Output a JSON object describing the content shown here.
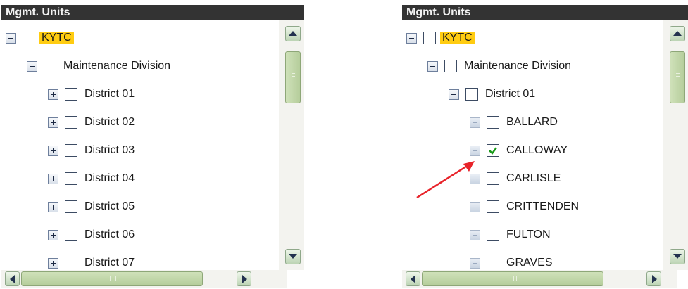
{
  "left_panel": {
    "title": "Mgmt. Units",
    "nodes": [
      {
        "label": "KYTC",
        "level": 0,
        "expander": "minus",
        "checked": false,
        "highlight": true
      },
      {
        "label": "Maintenance Division",
        "level": 1,
        "expander": "minus",
        "checked": false
      },
      {
        "label": "District 01",
        "level": 2,
        "expander": "plus",
        "checked": false
      },
      {
        "label": "District 02",
        "level": 2,
        "expander": "plus",
        "checked": false
      },
      {
        "label": "District 03",
        "level": 2,
        "expander": "plus",
        "checked": false
      },
      {
        "label": "District 04",
        "level": 2,
        "expander": "plus",
        "checked": false
      },
      {
        "label": "District 05",
        "level": 2,
        "expander": "plus",
        "checked": false
      },
      {
        "label": "District 06",
        "level": 2,
        "expander": "plus",
        "checked": false
      },
      {
        "label": "District 07",
        "level": 2,
        "expander": "plus",
        "checked": false
      }
    ]
  },
  "right_panel": {
    "title": "Mgmt. Units",
    "nodes": [
      {
        "label": "KYTC",
        "level": 0,
        "expander": "minus",
        "checked": false,
        "highlight": true
      },
      {
        "label": "Maintenance Division",
        "level": 1,
        "expander": "minus",
        "checked": false
      },
      {
        "label": "District 01",
        "level": 2,
        "expander": "minus",
        "checked": false
      },
      {
        "label": "BALLARD",
        "level": 3,
        "expander": "leaf",
        "checked": false
      },
      {
        "label": "CALLOWAY",
        "level": 3,
        "expander": "leaf",
        "checked": true
      },
      {
        "label": "CARLISLE",
        "level": 3,
        "expander": "leaf",
        "checked": false
      },
      {
        "label": "CRITTENDEN",
        "level": 3,
        "expander": "leaf",
        "checked": false
      },
      {
        "label": "FULTON",
        "level": 3,
        "expander": "leaf",
        "checked": false
      },
      {
        "label": "GRAVES",
        "level": 3,
        "expander": "leaf",
        "checked": false
      }
    ]
  },
  "colors": {
    "title_bar": "#333333",
    "highlight": "#ffcc11",
    "checkmark": "#1a9a1a",
    "annotation_arrow": "#e8232a",
    "scrollbar": "#b5cd9b"
  }
}
